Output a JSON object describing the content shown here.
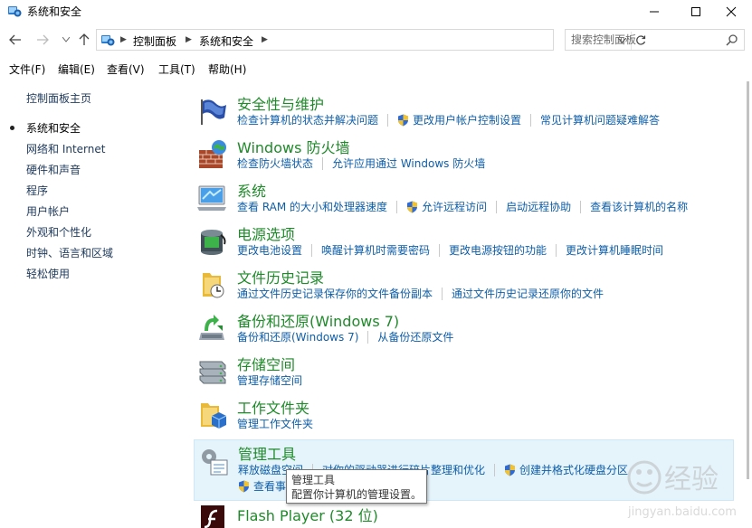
{
  "window": {
    "title": "系统和安全",
    "minimize_glyph": "—",
    "maximize_glyph": "☐",
    "close_glyph": "✕"
  },
  "nav": {
    "breadcrumb": [
      "控制面板",
      "系统和安全"
    ],
    "search": {
      "placeholder": "搜索控制面板",
      "value": ""
    }
  },
  "menu": [
    {
      "label": "文件(F)"
    },
    {
      "label": "编辑(E)"
    },
    {
      "label": "查看(V)"
    },
    {
      "label": "工具(T)"
    },
    {
      "label": "帮助(H)"
    }
  ],
  "sidebar": {
    "home": "控制面板主页",
    "items": [
      {
        "label": "系统和安全",
        "current": true
      },
      {
        "label": "网络和 Internet"
      },
      {
        "label": "硬件和声音"
      },
      {
        "label": "程序"
      },
      {
        "label": "用户帐户"
      },
      {
        "label": "外观和个性化"
      },
      {
        "label": "时钟、语言和区域"
      },
      {
        "label": "轻松使用"
      }
    ]
  },
  "categories": [
    {
      "title": "安全性与维护",
      "icon": "security-flag-icon",
      "links": [
        {
          "label": "检查计算机的状态并解决问题"
        },
        {
          "label": "更改用户帐户控制设置",
          "shield": true
        },
        {
          "label": "常见计算机问题疑难解答"
        }
      ]
    },
    {
      "title": "Windows 防火墙",
      "icon": "firewall-icon",
      "links": [
        {
          "label": "检查防火墙状态"
        },
        {
          "label": "允许应用通过 Windows 防火墙"
        }
      ]
    },
    {
      "title": "系统",
      "icon": "system-computer-icon",
      "links": [
        {
          "label": "查看 RAM 的大小和处理器速度"
        },
        {
          "label": "允许远程访问",
          "shield": true
        },
        {
          "label": "启动远程协助"
        },
        {
          "label": "查看该计算机的名称"
        }
      ]
    },
    {
      "title": "电源选项",
      "icon": "power-battery-icon",
      "links": [
        {
          "label": "更改电池设置"
        },
        {
          "label": "唤醒计算机时需要密码"
        },
        {
          "label": "更改电源按钮的功能"
        },
        {
          "label": "更改计算机睡眠时间"
        }
      ]
    },
    {
      "title": "文件历史记录",
      "icon": "file-history-icon",
      "links": [
        {
          "label": "通过文件历史记录保存你的文件备份副本"
        },
        {
          "label": "通过文件历史记录还原你的文件"
        }
      ]
    },
    {
      "title": "备份和还原(Windows 7)",
      "icon": "backup-restore-icon",
      "links": [
        {
          "label": "备份和还原(Windows 7)"
        },
        {
          "label": "从备份还原文件"
        }
      ]
    },
    {
      "title": "存储空间",
      "icon": "storage-spaces-icon",
      "links": [
        {
          "label": "管理存储空间"
        }
      ]
    },
    {
      "title": "工作文件夹",
      "icon": "work-folders-icon",
      "links": [
        {
          "label": "管理工作文件夹"
        }
      ]
    },
    {
      "title": "管理工具",
      "icon": "admin-tools-icon",
      "links": [
        {
          "label": "释放磁盘空间"
        },
        {
          "label": "对你的驱动器进行碎片整理和优化"
        },
        {
          "label": "创建并格式化硬盘分区",
          "shield": true
        }
      ],
      "links2": [
        {
          "label": "查看事",
          "shield": true
        }
      ]
    },
    {
      "title": "Flash Player (32 位)",
      "icon": "flash-player-icon",
      "links": []
    }
  ],
  "tooltip": {
    "title": "管理工具",
    "text": "配置你计算机的管理设置。"
  },
  "watermark": {
    "text": "经验",
    "url": "jingyan.baidu.com"
  },
  "colors": {
    "category_title": "#1f8a2a",
    "link": "#0e5ea8",
    "sidebar_link": "#1e395b",
    "hover_bg": "#e5f3fb"
  }
}
